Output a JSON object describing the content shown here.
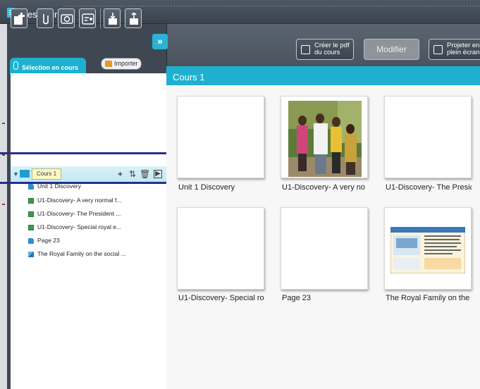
{
  "window": {
    "title": "Mes cours"
  },
  "toolbar": {
    "buttons": [
      "add-icon",
      "attachment-icon",
      "camera-icon",
      "settings-icon",
      "download-icon",
      "export-icon"
    ]
  },
  "left": {
    "tab_label": "Sélection en cours",
    "import_label": "Importer",
    "tree": {
      "root_label": "Cours 1",
      "items": [
        {
          "label": "Unit 1 Discovery",
          "icon": "document-icon"
        },
        {
          "label": "U1-Discovery- A very normal f...",
          "icon": "image-icon"
        },
        {
          "label": "U1-Discovery- The President ...",
          "icon": "image-icon"
        },
        {
          "label": "U1-Discovery- Special royal e...",
          "icon": "image-icon"
        },
        {
          "label": "Page 23",
          "icon": "document-icon"
        },
        {
          "label": "The Royal Family on the social ...",
          "icon": "picture-icon"
        }
      ]
    }
  },
  "right": {
    "collapse_label": "»",
    "pdf_button": {
      "line1": "Créer le pdf",
      "line2": "du cours"
    },
    "modify_button": "Modifier",
    "project_button": {
      "line1": "Projeter en",
      "line2": "plein écran"
    },
    "course_title": "Cours 1",
    "cards": [
      {
        "label": "Unit 1 Discovery",
        "thumb": "blank"
      },
      {
        "label": "U1-Discovery- A very no",
        "thumb": "photo"
      },
      {
        "label": "U1-Discovery- The Presic",
        "thumb": "blank"
      },
      {
        "label": "U1-Discovery- Special ro",
        "thumb": "blank"
      },
      {
        "label": "Page 23",
        "thumb": "blank"
      },
      {
        "label": "The Royal Family on the s",
        "thumb": "document"
      }
    ]
  },
  "colors": {
    "accent": "#1fb0d0",
    "panel": "#3f4852",
    "highlight": "#24308a"
  }
}
